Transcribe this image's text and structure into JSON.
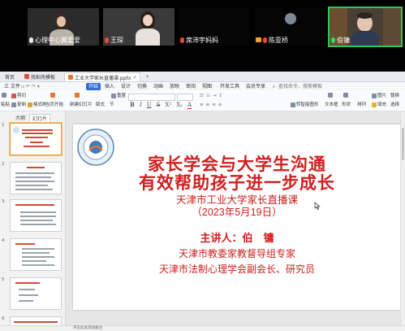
{
  "participants": [
    {
      "name": "心理中心翼爱爱",
      "mic": "on"
    },
    {
      "name": "王琛",
      "mic": "muted"
    },
    {
      "name": "席沛宇妈妈",
      "mic": "muted"
    },
    {
      "name": "陈亚桥",
      "mic": "camera"
    },
    {
      "name": "伯镛",
      "mic": "speaking"
    }
  ],
  "tabs": {
    "home": "首页",
    "template": "找稻壳模板",
    "file": "工业大学家长直播课.pptx"
  },
  "menu": {
    "items": [
      "三 文件",
      "开始",
      "插入",
      "设计",
      "切换",
      "动画",
      "放映",
      "审阅",
      "视图",
      "开发工具",
      "会员专享"
    ],
    "active_index": 1,
    "search": "查找命令、搜索模板"
  },
  "ribbon": {
    "paste": "粘贴",
    "cut": "剪切",
    "copy": "复制",
    "format_painter": "格式刷",
    "from_current": "当页开始",
    "new_slide": "新建幻灯片",
    "layout": "版式",
    "section": "节",
    "reset": "重置",
    "textbox": "文本框",
    "shape": "形状",
    "arrange": "排列",
    "image": "图片",
    "fill": "填充",
    "outline": "轮廓",
    "replace": "替换",
    "convert_smart": "转智能图形",
    "select": "选择"
  },
  "left_pane": {
    "outline_tab": "大纲",
    "slides_tab": "幻灯片",
    "thumb_numbers": [
      "1",
      "2",
      "3",
      "4",
      "5",
      "6"
    ]
  },
  "slide": {
    "title_line1": "家长学会与大学生沟通",
    "title_line2": "有效帮助孩子进一步成长",
    "subtitle_line1": "天津市工业大学家长直播课",
    "subtitle_line2": "（2023年5月19日）",
    "speaker": "主讲人：伯　镛",
    "role_line1": "天津市教委家教督导组专家",
    "role_line2": "天津市法制心理学会副会长、研究员"
  },
  "status": {
    "notes": "单击此处添加备注"
  },
  "colors": {
    "accent": "#2f6bd8",
    "title_red": "#d01f1f",
    "speaking_green": "#2ec85a"
  }
}
